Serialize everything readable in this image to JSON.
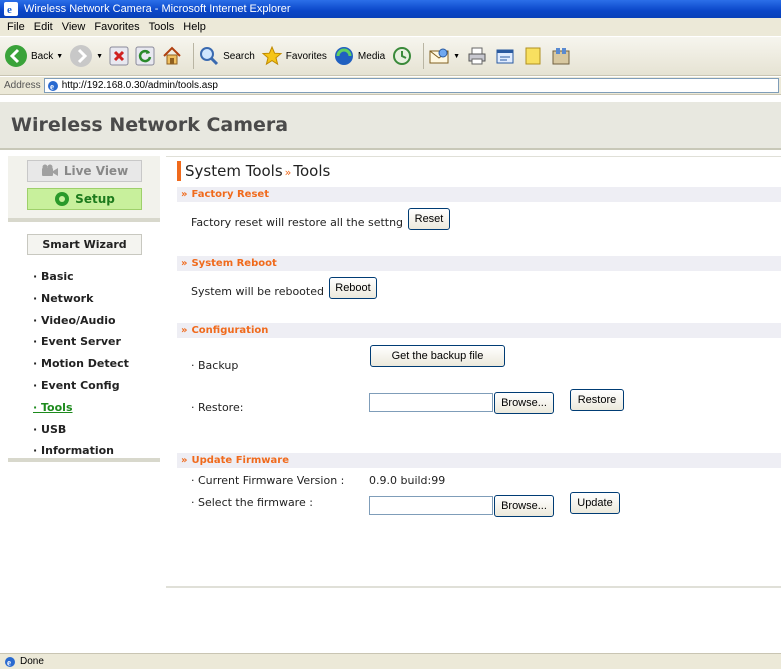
{
  "window": {
    "title": "Wireless Network Camera - Microsoft Internet Explorer"
  },
  "menubar": [
    "File",
    "Edit",
    "View",
    "Favorites",
    "Tools",
    "Help"
  ],
  "toolbar": {
    "back_label": "Back",
    "search_label": "Search",
    "favorites_label": "Favorites",
    "media_label": "Media"
  },
  "address": {
    "label": "Address",
    "url": "http://192.168.0.30/admin/tools.asp"
  },
  "page": {
    "site_title": "Wireless Network Camera"
  },
  "sidebar": {
    "live_view": "Live View",
    "setup": "Setup",
    "smart_wizard": "Smart Wizard",
    "items": [
      {
        "label": "Basic",
        "active": false
      },
      {
        "label": "Network",
        "active": false
      },
      {
        "label": "Video/Audio",
        "active": false
      },
      {
        "label": "Event Server",
        "active": false
      },
      {
        "label": "Motion Detect",
        "active": false
      },
      {
        "label": "Event Config",
        "active": false
      },
      {
        "label": "Tools",
        "active": true
      },
      {
        "label": "USB",
        "active": false
      },
      {
        "label": "Information",
        "active": false
      }
    ]
  },
  "main": {
    "title_part1": "System Tools",
    "title_sep": "»",
    "title_part2": "Tools",
    "factory_reset": {
      "heading": "Factory Reset",
      "text": "Factory reset will restore all the settng",
      "button": "Reset"
    },
    "system_reboot": {
      "heading": "System Reboot",
      "text": "System will be rebooted",
      "button": "Reboot"
    },
    "configuration": {
      "heading": "Configuration",
      "backup_label": "· Backup",
      "backup_button": "Get the backup file",
      "restore_label": "· Restore:",
      "browse_button": "Browse...",
      "restore_button": "Restore"
    },
    "update_firmware": {
      "heading": "Update Firmware",
      "current_label": "· Current Firmware Version :",
      "current_value": "0.9.0 build:99",
      "select_label": "· Select the firmware :",
      "browse_button": "Browse...",
      "update_button": "Update"
    }
  },
  "status": {
    "text": "Done"
  },
  "colors": {
    "accent_orange": "#f06a1c",
    "setup_green": "#c8f09c",
    "active_link_green": "#1c8a1c"
  }
}
